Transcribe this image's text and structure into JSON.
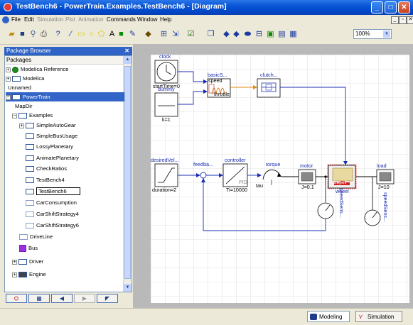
{
  "window": {
    "title": "TestBench6 - PowerTrain.Examples.TestBench6 - [Diagram]"
  },
  "menu": [
    "File",
    "Edit",
    "Simulation",
    "Plot",
    "Animation",
    "Commands",
    "Window",
    "Help"
  ],
  "toolbar": {
    "zoom": "100%"
  },
  "package_browser": {
    "title": "Package Browser",
    "column": "Packages",
    "items": [
      "Modelica Reference",
      "Modelica",
      "Unnamed",
      "PowerTrain",
      "MapDir",
      "Examples",
      "SimpleAutoGear",
      "SimpleBusUsage",
      "LossyPlanetary",
      "AnimatePlanetary",
      "CheckRatios",
      "TestBench4",
      "TestBench6",
      "CarConsumption",
      "CarShiftStrategy4",
      "CarShiftStrategy6",
      "DriveLine",
      "Bus",
      "Driver",
      "Engine"
    ]
  },
  "diagram": {
    "clock": {
      "name": "clock",
      "param": "startTime=0"
    },
    "dummy": {
      "name": "dummy",
      "param": "k=1"
    },
    "basicS": {
      "name": "basicS...",
      "port1": "speed",
      "port2": "throttle"
    },
    "clutch": {
      "name": "clutch..."
    },
    "desiredVel": {
      "name": "desiredVel...",
      "param": "duration=2"
    },
    "feedback": {
      "name": "feedba..."
    },
    "controller": {
      "name": "controller",
      "inner": "PID",
      "param": "Ti=10000"
    },
    "torque": {
      "name": "torque",
      "tau": "tau"
    },
    "motor": {
      "name": "motor",
      "param": "J=0.1"
    },
    "wheel": {
      "name": "wheel",
      "inner": "Lepell"
    },
    "load": {
      "name": "load",
      "param": "J=10"
    },
    "speedSens1": {
      "name": "speedSens..."
    },
    "speedSens2": {
      "name": "speedSens..."
    }
  },
  "tabs": {
    "modeling": "Modeling",
    "simulation": "Simulation"
  }
}
